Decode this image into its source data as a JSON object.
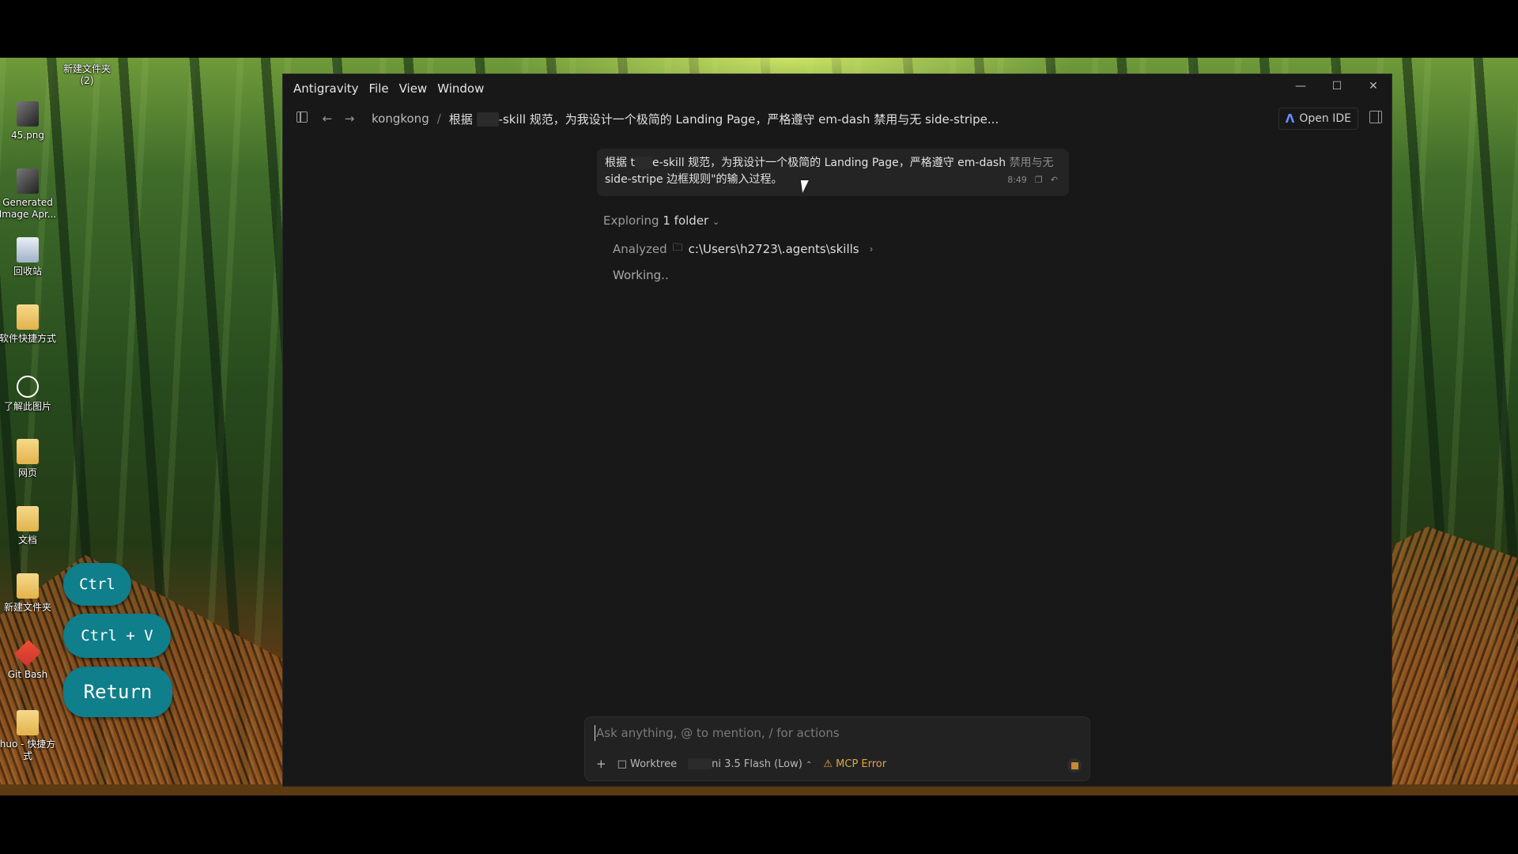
{
  "desktop_icons": [
    {
      "label": "新建文件夹 (2)",
      "icon": "folder-icon"
    },
    {
      "label": "45.png",
      "icon": "image-file-icon"
    },
    {
      "label": "Generated Image Apr...",
      "icon": "image-file-icon"
    },
    {
      "label": "回收站",
      "icon": "recycle-bin-icon"
    },
    {
      "label": "软件快捷方式",
      "icon": "folder-icon"
    },
    {
      "label": "了解此图片",
      "icon": "info-circle-icon"
    },
    {
      "label": "网页",
      "icon": "folder-icon"
    },
    {
      "label": "文档",
      "icon": "folder-icon"
    },
    {
      "label": "新建文件夹",
      "icon": "folder-icon"
    },
    {
      "label": "Git Bash",
      "icon": "git-bash-icon"
    },
    {
      "label": "huo - 快捷方式",
      "icon": "shortcut-icon"
    }
  ],
  "key_overlays": {
    "k1": "Ctrl",
    "k2": "Ctrl + V",
    "k3": "Return"
  },
  "window": {
    "menu": {
      "app": "Antigravity",
      "file": "File",
      "view": "View",
      "window": "Window"
    },
    "breadcrumb": {
      "workspace": "kongkong",
      "separator": "/",
      "title_prefix": "根据",
      "title_rest": "-skill 规范，为我设计一个极简的 Landing Page，严格遵守 em-dash 禁用与无 side-stripe..."
    },
    "open_ide_label": "Open IDE",
    "user_message": {
      "line1_prefix": "根据 t",
      "line1_main": "e-skill 规范，为我设计一个极简的 Landing Page，严格遵守 em-dash ",
      "line1_faded": "禁用与无",
      "line2": "side-stripe 边框规则\"的输入过程。",
      "time": "8:49"
    },
    "exploring": {
      "prefix": "Exploring",
      "count": "1 folder"
    },
    "analyzed": {
      "label": "Analyzed",
      "path": "c:\\Users\\h2723\\.agents\\skills"
    },
    "status": "Working..",
    "composer": {
      "placeholder": "Ask anything, @ to mention, / for actions",
      "add": "+",
      "worktree": "Worktree",
      "model": "ni 3.5 Flash (Low)",
      "mcp_error": "MCP Error"
    }
  },
  "colors": {
    "accent_key": "#0e7f8b",
    "warning": "#e0a640",
    "window_bg": "#181818"
  }
}
